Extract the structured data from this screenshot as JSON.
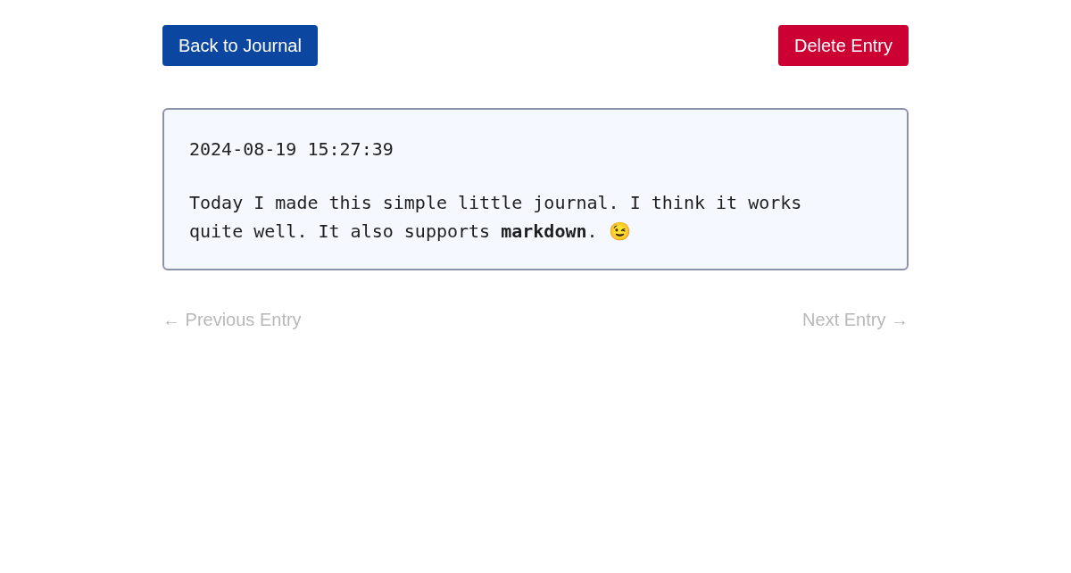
{
  "header_buttons": [
    {
      "label": "Back to Journal",
      "kind": "primary"
    },
    {
      "label": "Delete Entry",
      "kind": "danger"
    }
  ],
  "entry": {
    "timestamp": "2024-08-19 15:27:39",
    "body": "Today I made this simple little journal. I think it works quite well. It also supports **markdown**. 😉"
  },
  "navigation": [
    {
      "label": "← Previous Entry",
      "disabled": true
    },
    {
      "label": "Next Entry →",
      "disabled": true
    }
  ]
}
